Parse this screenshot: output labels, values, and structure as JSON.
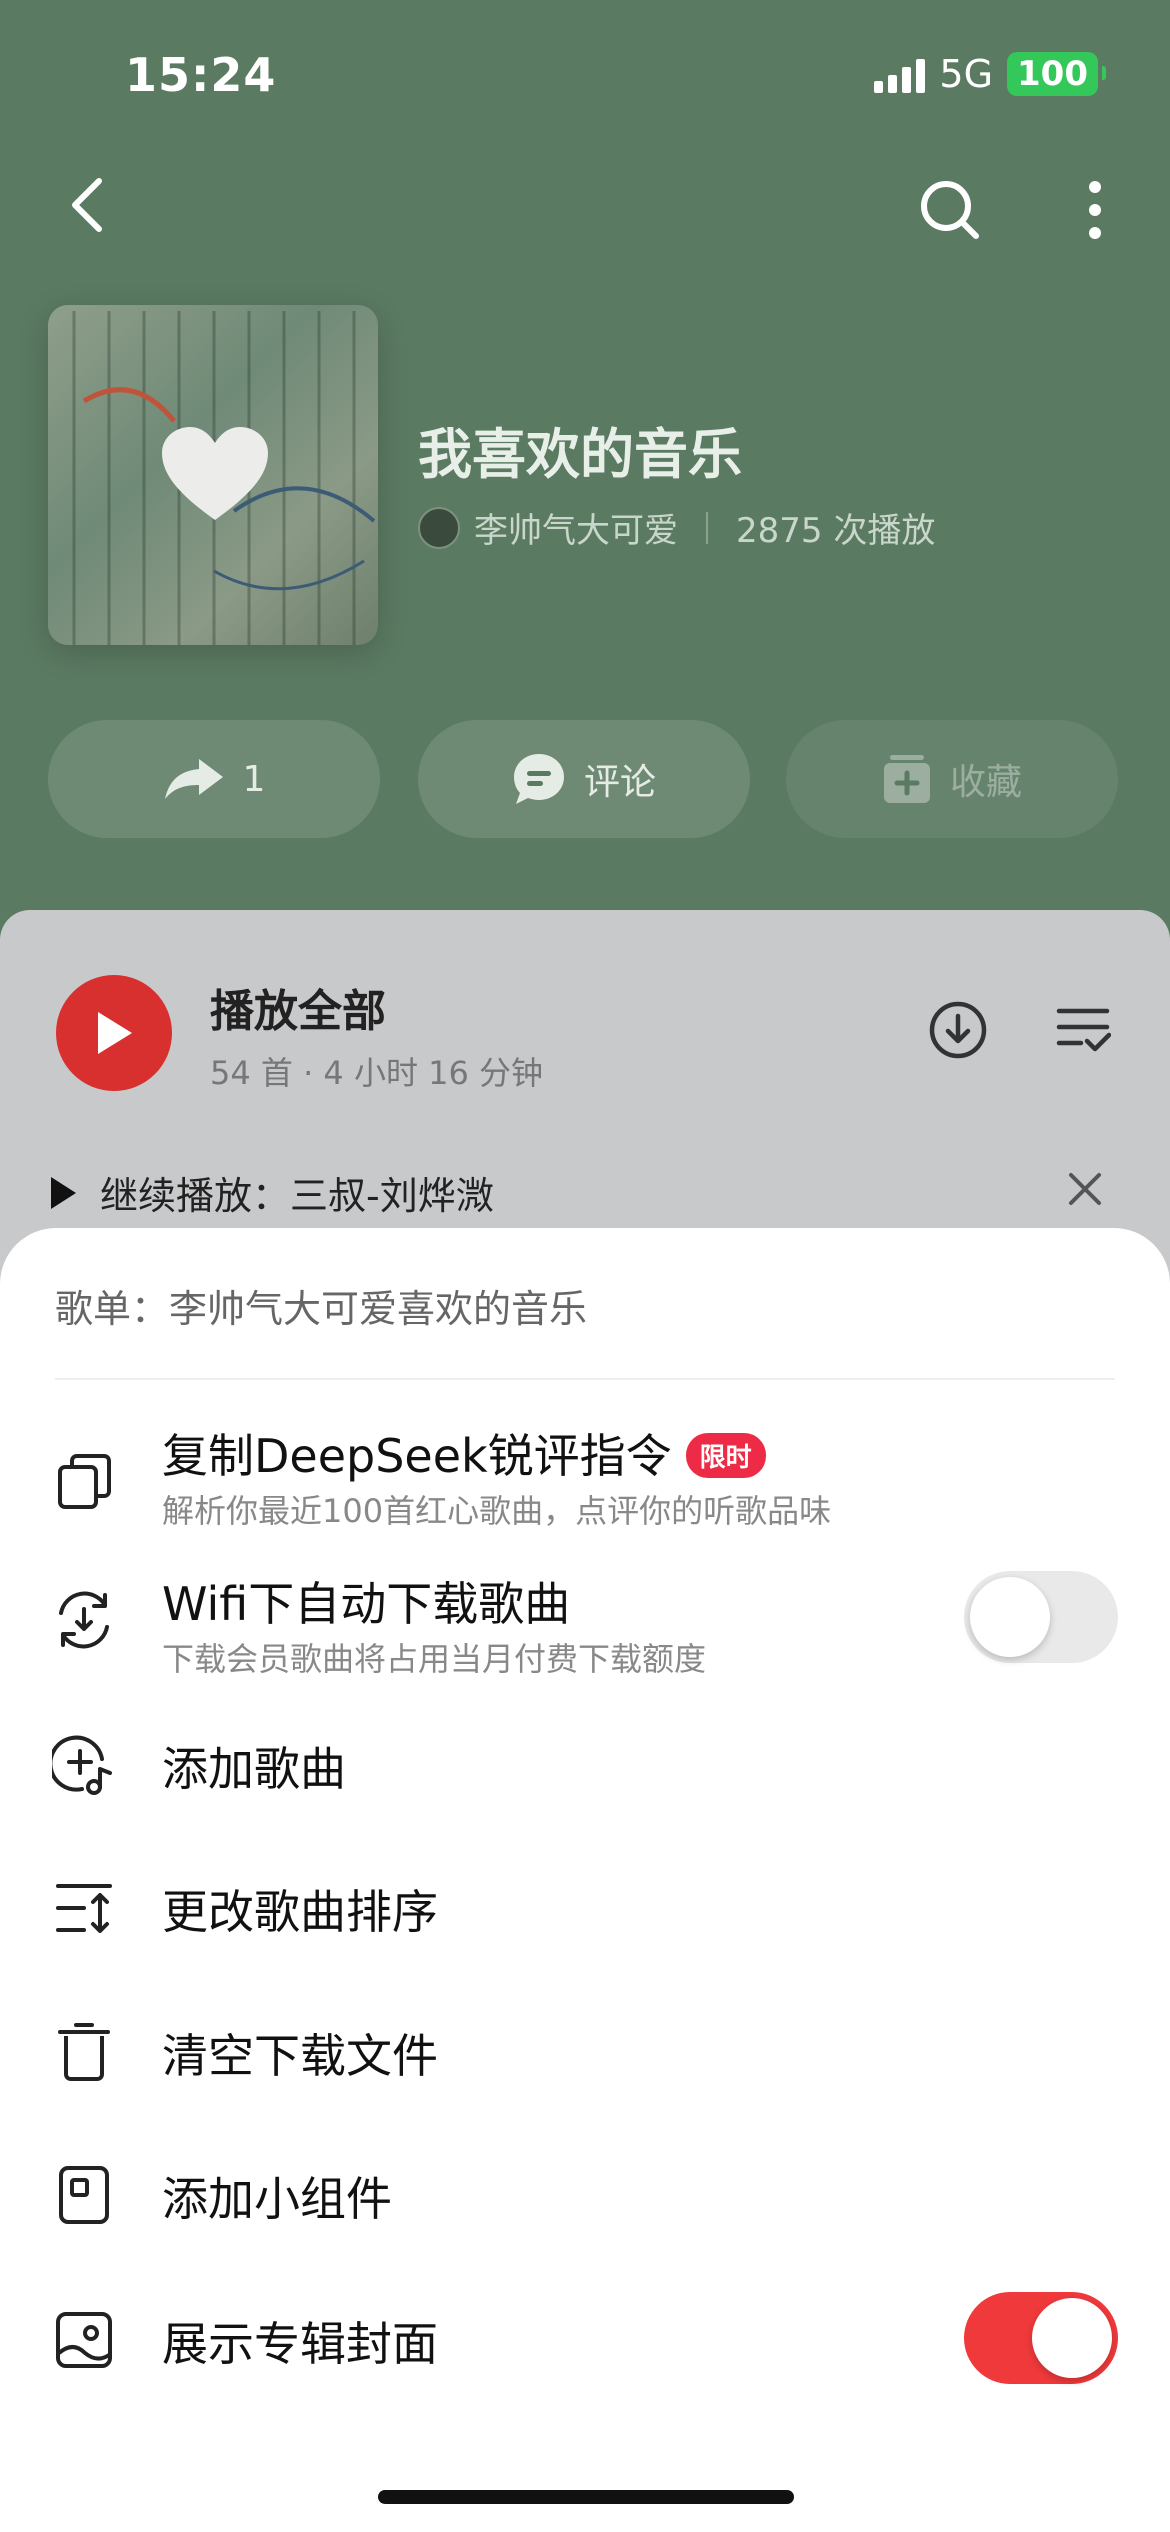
{
  "status_bar": {
    "time": "15:24",
    "network": "5G",
    "battery": "100"
  },
  "header": {
    "back_icon": "chevron-left-icon",
    "search_icon": "search-icon",
    "more_icon": "more-vertical-icon"
  },
  "playlist": {
    "title": "我喜欢的音乐",
    "creator": "李帅气大可爱",
    "play_count": "2875 次播放"
  },
  "actions": {
    "share_count": "1",
    "comment_label": "评论",
    "collect_label": "收藏"
  },
  "list": {
    "play_all_label": "播放全部",
    "summary": "54 首 · 4 小时 16 分钟",
    "continue_label": "继续播放：三叔-刘烨溦"
  },
  "sheet": {
    "header": "歌单：李帅气大可爱喜欢的音乐",
    "items": [
      {
        "label": "复制DeepSeek锐评指令",
        "badge": "限时",
        "sub": "解析你最近100首红心歌曲，点评你的听歌品味",
        "icon": "copy-icon"
      },
      {
        "label": "Wifi下自动下载歌曲",
        "sub": "下载会员歌曲将占用当月付费下载额度",
        "icon": "auto-download-icon",
        "toggle": false
      },
      {
        "label": "添加歌曲",
        "icon": "add-song-icon"
      },
      {
        "label": "更改歌曲排序",
        "icon": "sort-icon"
      },
      {
        "label": "清空下载文件",
        "icon": "trash-icon"
      },
      {
        "label": "添加小组件",
        "icon": "widget-icon"
      },
      {
        "label": "展示专辑封面",
        "icon": "album-cover-icon",
        "toggle": true
      }
    ]
  },
  "colors": {
    "accent": "#f0393b",
    "background": "#5b7a62",
    "play_button": "#d8302f",
    "badge": "#ee2b46"
  }
}
